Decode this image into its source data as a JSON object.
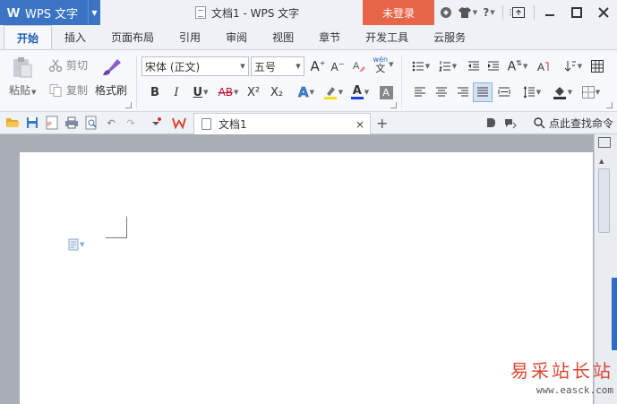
{
  "titlebar": {
    "app_name": "WPS 文字",
    "logo_letter": "W",
    "document_title": "文档1 - WPS 文字",
    "login_label": "未登录",
    "help_label": "?"
  },
  "menu": {
    "tabs": [
      {
        "label": "开始",
        "active": true
      },
      {
        "label": "插入"
      },
      {
        "label": "页面布局"
      },
      {
        "label": "引用"
      },
      {
        "label": "审阅"
      },
      {
        "label": "视图"
      },
      {
        "label": "章节"
      },
      {
        "label": "开发工具"
      },
      {
        "label": "云服务"
      }
    ]
  },
  "ribbon": {
    "paste_label": "粘贴",
    "cut_label": "剪切",
    "copy_label": "复制",
    "format_painter_label": "格式刷",
    "font_name": "宋体 (正文)",
    "font_size": "五号",
    "bold": "B",
    "italic": "I",
    "underline": "U",
    "strike": "AB",
    "superscript": "X²",
    "subscript": "X₂",
    "font_color_letter": "A",
    "pinyin_label": "wén",
    "pinyin_char": "文"
  },
  "quickbar": {
    "doc_tab_label": "文档1",
    "close_label": "×",
    "add_label": "+",
    "search_command_label": "点此查找命令"
  },
  "watermark": {
    "text_cn": "易采站长站",
    "url": "www.easck.com"
  },
  "colors": {
    "accent_blue": "#3c74c4",
    "login_orange": "#e8654a",
    "wps_red": "#d9472f",
    "page": "#ffffff",
    "workspace": "#a9adb5"
  }
}
